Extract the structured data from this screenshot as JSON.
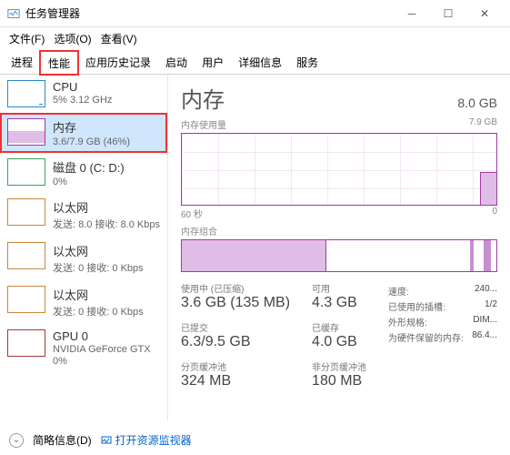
{
  "titlebar": {
    "title": "任务管理器"
  },
  "menubar": {
    "file": "文件(F)",
    "options": "选项(O)",
    "view": "查看(V)"
  },
  "tabs": [
    "进程",
    "性能",
    "应用历史记录",
    "启动",
    "用户",
    "详细信息",
    "服务"
  ],
  "left": {
    "cpu": {
      "title": "CPU",
      "sub": "5% 3.12 GHz"
    },
    "mem": {
      "title": "内存",
      "sub": "3.6/7.9 GB (46%)"
    },
    "disk": {
      "title": "磁盘 0 (C: D:)",
      "sub": "0%"
    },
    "eth1": {
      "title": "以太网",
      "sub": "发送: 8.0 接收: 8.0 Kbps"
    },
    "eth2": {
      "title": "以太网",
      "sub": "发送: 0 接收: 0 Kbps"
    },
    "eth3": {
      "title": "以太网",
      "sub": "发送: 0 接收: 0 Kbps"
    },
    "gpu": {
      "title": "GPU 0",
      "sub1": "NVIDIA GeForce GTX",
      "sub2": "0%"
    }
  },
  "right": {
    "heading": "内存",
    "total": "8.0 GB",
    "chart1_label": "内存使用量",
    "chart1_max": "7.9 GB",
    "xaxis_left": "60 秒",
    "xaxis_right": "0",
    "chart2_label": "内存组合",
    "stats": {
      "inuse_lbl": "使用中 (已压缩)",
      "inuse_val": "3.6 GB (135 MB)",
      "avail_lbl": "可用",
      "avail_val": "4.3 GB",
      "commit_lbl": "已提交",
      "commit_val": "6.3/9.5 GB",
      "cached_lbl": "已缓存",
      "cached_val": "4.0 GB",
      "paged_lbl": "分页缓冲池",
      "paged_val": "324 MB",
      "nonpaged_lbl": "非分页缓冲池",
      "nonpaged_val": "180 MB"
    },
    "spec": {
      "speed_lbl": "速度:",
      "speed_val": "240...",
      "slots_lbl": "已使用的插槽:",
      "slots_val": "1/2",
      "form_lbl": "外形规格:",
      "form_val": "DIM...",
      "reserved_lbl": "为硬件保留的内存:",
      "reserved_val": "86.4..."
    }
  },
  "footer": {
    "brief": "简略信息(D)",
    "link": "打开资源监视器"
  },
  "chart_data": {
    "type": "line",
    "title": "内存使用量",
    "xlabel": "60 秒",
    "ylabel": "",
    "ylim": [
      0,
      7.9
    ],
    "x": [
      60,
      0
    ],
    "series": [
      {
        "name": "内存",
        "values_recent": 3.6
      }
    ],
    "composition": {
      "in_use_gb": 3.6,
      "available_gb": 4.3,
      "total_gb": 7.9
    }
  }
}
